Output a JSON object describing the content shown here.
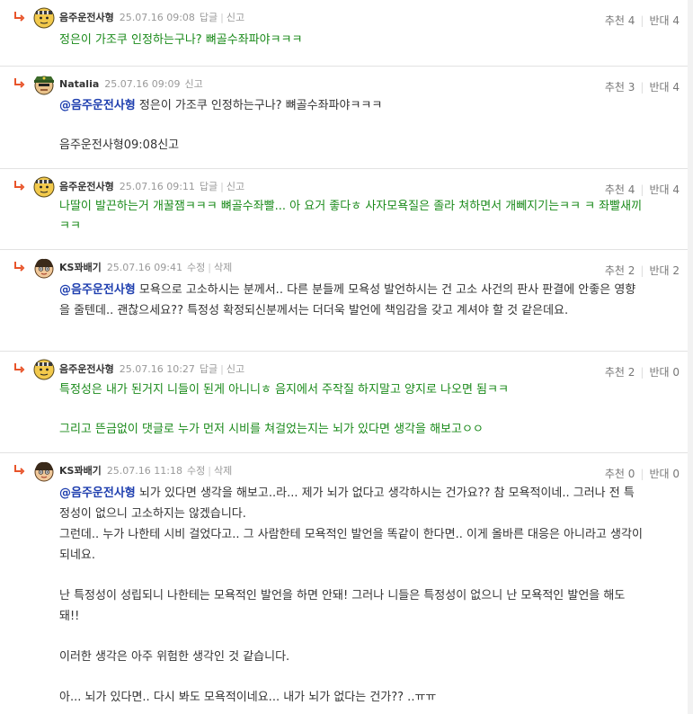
{
  "comments": [
    {
      "nick": "음주운전사형",
      "date": "25.07.16 09:08",
      "actions": [
        "답글",
        "신고"
      ],
      "up_label": "추천",
      "up": "4",
      "down_label": "반대",
      "down": "4",
      "avatar": "prisoner-avatar-icon",
      "color": "green",
      "mention": "",
      "paras": [
        "정은이 가조쿠 인정하는구나? 뼈골수좌파야ㅋㅋㅋ"
      ]
    },
    {
      "nick": "Natalia",
      "date": "25.07.16 09:09",
      "actions": [
        "신고"
      ],
      "up_label": "추천",
      "up": "3",
      "down_label": "반대",
      "down": "4",
      "avatar": "soldier-avatar-icon",
      "color": "normal",
      "mention": "@음주운전사형",
      "paras": [
        " 정은이 가조쿠 인정하는구나? 뼈골수좌파야ㅋㅋㅋ",
        "",
        "음주운전사형09:08신고"
      ]
    },
    {
      "nick": "음주운전사형",
      "date": "25.07.16 09:11",
      "actions": [
        "답글",
        "신고"
      ],
      "up_label": "추천",
      "up": "4",
      "down_label": "반대",
      "down": "4",
      "avatar": "prisoner-avatar-icon",
      "color": "green",
      "mention": "",
      "paras": [
        "나딸이 발끈하는거 개꿀잼ㅋㅋㅋ 뼈골수좌빨... 아 요거 좋다ㅎ 사자모욕질은 졸라 쳐하면서 개뻬지기는ㅋㅋ ㅋ 좌빨새끼ㅋㅋ"
      ]
    },
    {
      "nick": "KS꽈배기",
      "date": "25.07.16 09:41",
      "actions": [
        "수정",
        "삭제"
      ],
      "up_label": "추천",
      "up": "2",
      "down_label": "반대",
      "down": "2",
      "avatar": "gamer-avatar-icon",
      "color": "normal",
      "mention": "@음주운전사형",
      "paras": [
        " 모욕으로 고소하시는 분께서.. 다른 분들께 모욕성 발언하시는 건 고소 사건의 판사 판결에 안좋은 영향을 줄텐데.. 괜찮으세요?? 특정성 확정되신분께서는 더더욱 발언에 책임감을 갖고 계셔야 할 것 같은데요."
      ]
    },
    {
      "nick": "음주운전사형",
      "date": "25.07.16 10:27",
      "actions": [
        "답글",
        "신고"
      ],
      "up_label": "추천",
      "up": "2",
      "down_label": "반대",
      "down": "0",
      "avatar": "prisoner-avatar-icon",
      "color": "green",
      "mention": "",
      "paras": [
        "특정성은 내가 된거지 니들이 된게 아니니ㅎ 음지에서 주작질 하지말고 양지로 나오면 됨ㅋㅋ",
        "",
        "그리고 뜬금없이 댓글로 누가 먼저 시비를 쳐걸었는지는 뇌가 있다면 생각을 해보고ㅇㅇ"
      ]
    },
    {
      "nick": "KS꽈배기",
      "date": "25.07.16 11:18",
      "actions": [
        "수정",
        "삭제"
      ],
      "up_label": "추천",
      "up": "0",
      "down_label": "반대",
      "down": "0",
      "avatar": "gamer-avatar-icon",
      "color": "normal",
      "mention": "@음주운전사형",
      "paras": [
        " 뇌가 있다면 생각을 해보고..라... 제가 뇌가 없다고 생각하시는 건가요?? 참 모욕적이네.. 그러나 전 특정성이 없으니 고소하지는 않겠습니다.\n그런데.. 누가 나한테 시비 걸었다고.. 그 사람한테 모욕적인 발언을 똑같이 한다면.. 이게 올바른 대응은 아니라고 생각이 되네요.",
        "",
        "난 특정성이 성립되니 나한테는 모욕적인 발언을 하면 안돼! 그러나 니들은 특정성이 없으니 난 모욕적인 발언을 해도돼!!",
        "",
        "이러한 생각은 아주 위험한 생각인 것 같습니다.",
        "",
        "아... 뇌가 있다면.. 다시 봐도 모욕적이네요... 내가 뇌가 없다는 건가?? ..ㅠㅠ"
      ]
    }
  ]
}
